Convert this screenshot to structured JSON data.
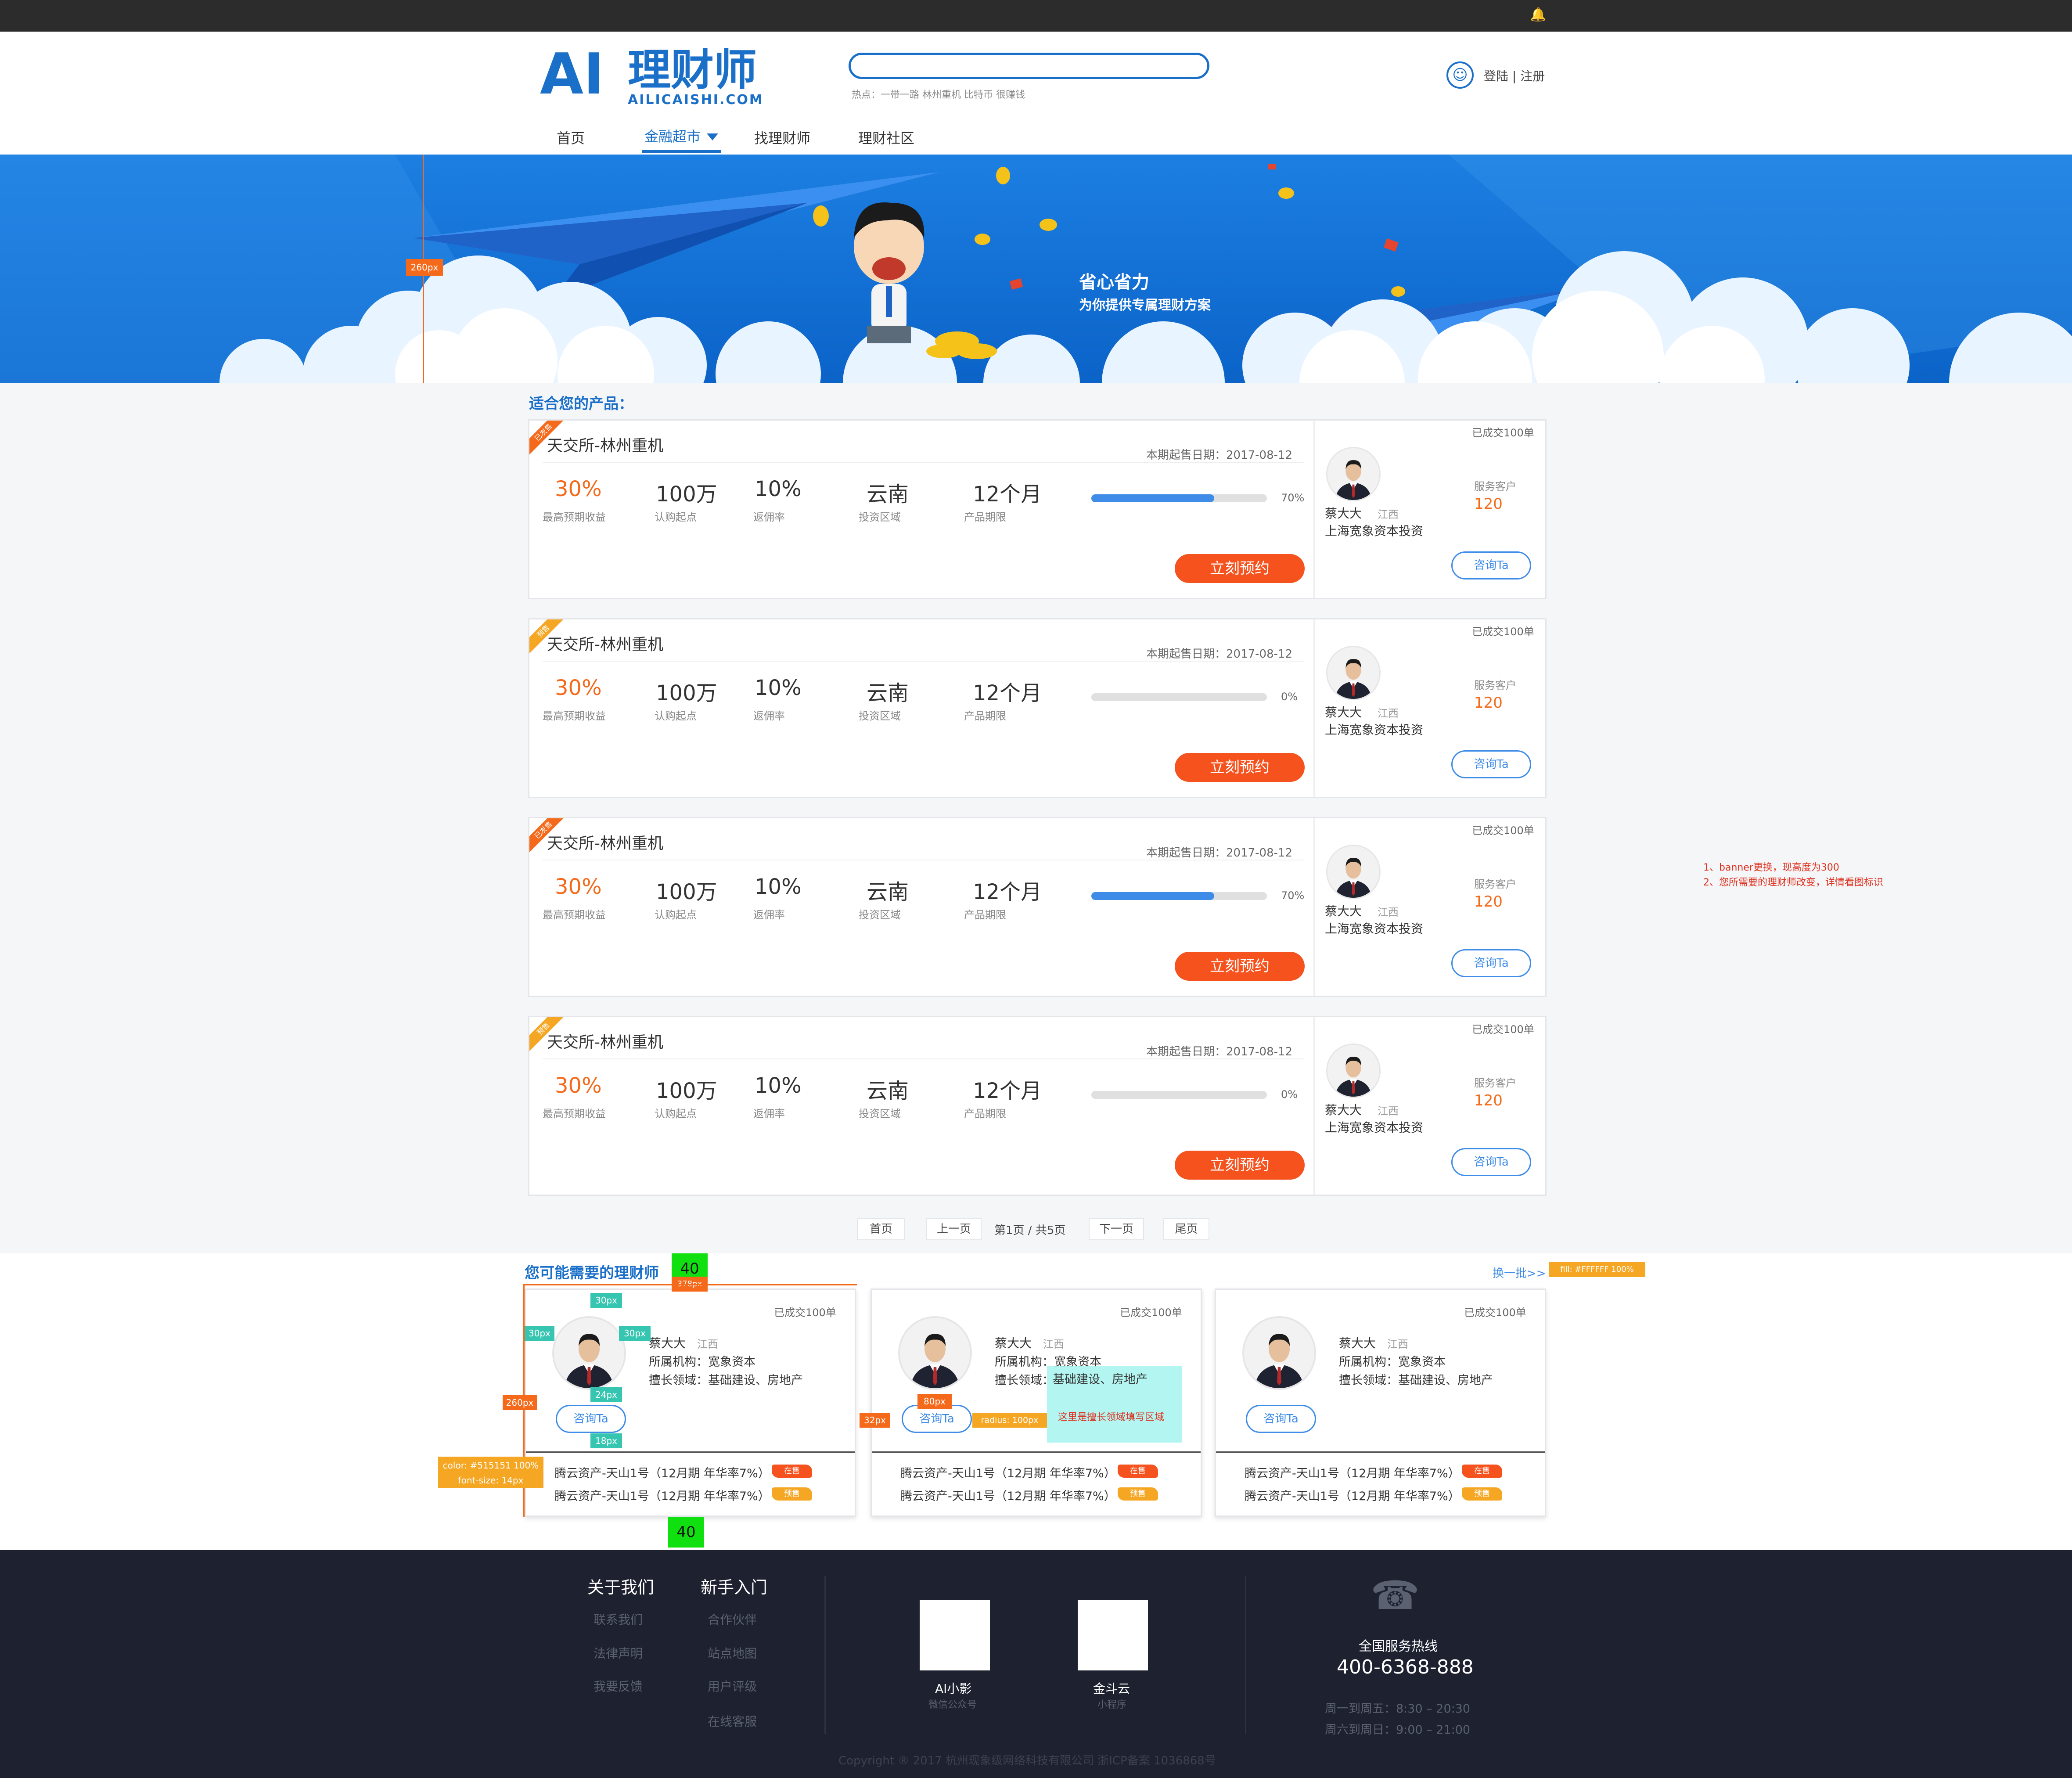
{
  "header": {
    "logo_ai": "AI",
    "logo_cn": "理财师",
    "logo_url": "AILICAISHI.COM",
    "search_placeholder": "",
    "hot": "热点：一带一路 林州重机 比特币 很赚钱",
    "login": "登陆 | 注册"
  },
  "nav": [
    {
      "label": "首页"
    },
    {
      "label": "金融超市"
    },
    {
      "label": "找理财师"
    },
    {
      "label": "理财社区"
    }
  ],
  "banner": {
    "title": "省心省力",
    "subtitle": "为你提供专属理财方案",
    "measure": "260px"
  },
  "products_section": {
    "title": "适合您的产品：",
    "items": [
      {
        "tag": "已发售",
        "name": "天交所-林州重机",
        "date": "本期起售日期：2017-08-12",
        "yield": "30%",
        "yield_label": "最高预期收益",
        "min": "100万",
        "min_label": "认购起点",
        "rebate": "10%",
        "rebate_label": "返佣率",
        "region": "云南",
        "region_label": "投资区域",
        "term": "12个月",
        "term_label": "产品期限",
        "progress": 0.7,
        "progress_text": "70%",
        "book": "立刻预约",
        "deals": "已成交100单",
        "advisor": "蔡大大",
        "province": "江西",
        "org": "上海宽象资本投资",
        "svc_label": "服务客户",
        "svc": "120",
        "consult": "咨询Ta",
        "tag_color": "#f56a1a"
      },
      {
        "tag": "预售",
        "name": "天交所-林州重机",
        "date": "本期起售日期：2017-08-12",
        "yield": "30%",
        "yield_label": "最高预期收益",
        "min": "100万",
        "min_label": "认购起点",
        "rebate": "10%",
        "rebate_label": "返佣率",
        "region": "云南",
        "region_label": "投资区域",
        "term": "12个月",
        "term_label": "产品期限",
        "progress": 0,
        "progress_text": "0%",
        "book": "立刻预约",
        "deals": "已成交100单",
        "advisor": "蔡大大",
        "province": "江西",
        "org": "上海宽象资本投资",
        "svc_label": "服务客户",
        "svc": "120",
        "consult": "咨询Ta",
        "tag_color": "#f5a623"
      },
      {
        "tag": "已发售",
        "name": "天交所-林州重机",
        "date": "本期起售日期：2017-08-12",
        "yield": "30%",
        "yield_label": "最高预期收益",
        "min": "100万",
        "min_label": "认购起点",
        "rebate": "10%",
        "rebate_label": "返佣率",
        "region": "云南",
        "region_label": "投资区域",
        "term": "12个月",
        "term_label": "产品期限",
        "progress": 0.7,
        "progress_text": "70%",
        "book": "立刻预约",
        "deals": "已成交100单",
        "advisor": "蔡大大",
        "province": "江西",
        "org": "上海宽象资本投资",
        "svc_label": "服务客户",
        "svc": "120",
        "consult": "咨询Ta",
        "tag_color": "#f56a1a"
      },
      {
        "tag": "预售",
        "name": "天交所-林州重机",
        "date": "本期起售日期：2017-08-12",
        "yield": "30%",
        "yield_label": "最高预期收益",
        "min": "100万",
        "min_label": "认购起点",
        "rebate": "10%",
        "rebate_label": "返佣率",
        "region": "云南",
        "region_label": "投资区域",
        "term": "12个月",
        "term_label": "产品期限",
        "progress": 0,
        "progress_text": "0%",
        "book": "立刻预约",
        "deals": "已成交100单",
        "advisor": "蔡大大",
        "province": "江西",
        "org": "上海宽象资本投资",
        "svc_label": "服务客户",
        "svc": "120",
        "consult": "咨询Ta",
        "tag_color": "#f5a623"
      }
    ]
  },
  "notes": {
    "line1": "1、banner更换，现高度为300",
    "line2": "2、您所需要的理财师改变，详情看图标识"
  },
  "pagination": {
    "first": "首页",
    "prev": "上一页",
    "info": "第1页 / 共5页",
    "next": "下一页",
    "last": "尾页"
  },
  "advisors_section": {
    "title": "您可能需要的理财师",
    "refresh": "换一批>>",
    "items": [
      {
        "deals": "已成交100单",
        "name": "蔡大大",
        "province": "江西",
        "org": "所属机构：宽象资本",
        "field": "擅长领域：基础建设、房地产",
        "consult": "咨询Ta",
        "prod1": "腾云资产-天山1号（12月期 年华率7%）",
        "badge1": "在售",
        "prod2": "腾云资产-天山1号（12月期 年华率7%）",
        "badge2": "预售"
      },
      {
        "deals": "已成交100单",
        "name": "蔡大大",
        "province": "江西",
        "org": "所属机构：宽象资本",
        "field_label": "擅长领域：",
        "field_value": "基础建设、房地产",
        "consult": "咨询Ta",
        "prod1": "腾云资产-天山1号（12月期 年华率7%）",
        "badge1": "在售",
        "prod2": "腾云资产-天山1号（12月期 年华率7%）",
        "badge2": "预售"
      },
      {
        "deals": "已成交100单",
        "name": "蔡大大",
        "province": "江西",
        "org": "所属机构：宽象资本",
        "field": "擅长领域：基础建设、房地产",
        "consult": "咨询Ta",
        "prod1": "腾云资产-天山1号（12月期 年华率7%）",
        "badge1": "在售",
        "prod2": "腾云资产-天山1号（12月期 年华率7%）",
        "badge2": "预售"
      }
    ],
    "callout": "这里是擅长领域填写区域"
  },
  "annotations": {
    "m40": "40",
    "m378": "378px",
    "m30a": "30px",
    "m30b": "30px",
    "m30c": "30px",
    "m24": "24px",
    "m18": "18px",
    "m260": "260px",
    "m80": "80px",
    "m32": "32px",
    "radius": "radius: 100px",
    "fill": "fill: #FFFFFF 100%",
    "color": "color: #515151 100%",
    "fontsize": "font-size: 14px",
    "m40b": "40"
  },
  "footer": {
    "about": "关于我们",
    "newbie": "新手入门",
    "col1": [
      "联系我们",
      "法律声明",
      "我要反馈"
    ],
    "col2": [
      "合作伙伴",
      "站点地图",
      "用户评级",
      "在线客服"
    ],
    "qr1_name": "AI小影",
    "qr1_sub": "微信公众号",
    "qr2_name": "金斗云",
    "qr2_sub": "小程序",
    "hotline_label": "全国服务热线",
    "hotline": "400-6368-888",
    "hours1": "周一到周五：8:30 – 20:30",
    "hours2": "周六到周日：9:00 – 21:00",
    "copyright": "Copyright ® 2017 杭州现象级网络科技有限公司 浙ICP备案 1036868号"
  },
  "colors": {
    "brand_blue": "#1a6fc9",
    "accent_orange": "#f56a1a",
    "footer_bg": "#1d2130"
  }
}
